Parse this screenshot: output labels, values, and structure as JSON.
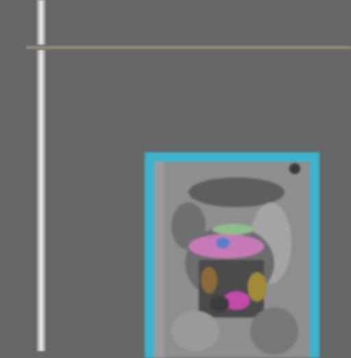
{
  "canvas": {
    "background_color": "#666666"
  },
  "guides": {
    "vertical_color": "#e6e6e6",
    "horizontal_color": "#9a9184"
  },
  "thumbnail": {
    "selected": true,
    "selection_color": "#3fb3cc",
    "icon": "poster-thumbnail-icon"
  }
}
